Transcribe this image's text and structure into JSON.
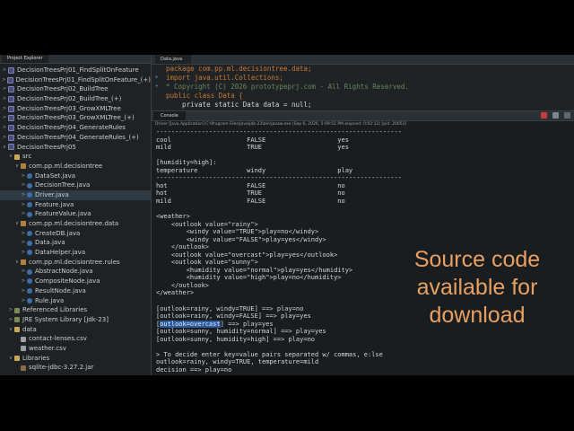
{
  "explorer": {
    "tab_label": "Project Explorer",
    "items": [
      {
        "label": "DecisionTreesPrj01_FindSplitOnFeature",
        "icon": "project-icon",
        "depth": 0,
        "twisty": ">"
      },
      {
        "label": "DecisionTreesPrj01_FindSplitOnFeature_(+)",
        "icon": "project-icon",
        "depth": 0,
        "twisty": ">"
      },
      {
        "label": "DecisionTreesPrj02_BuildTree",
        "icon": "project-icon",
        "depth": 0,
        "twisty": ">"
      },
      {
        "label": "DecisionTreesPrj02_BuildTree_(+)",
        "icon": "project-icon",
        "depth": 0,
        "twisty": ">"
      },
      {
        "label": "DecisionTreesPrj03_GrowXMLTree",
        "icon": "project-icon",
        "depth": 0,
        "twisty": ">"
      },
      {
        "label": "DecisionTreesPrj03_GrowXMLTree_(+)",
        "icon": "project-icon",
        "depth": 0,
        "twisty": ">"
      },
      {
        "label": "DecisionTreesPrj04_GenerateRules",
        "icon": "project-icon",
        "depth": 0,
        "twisty": ">"
      },
      {
        "label": "DecisionTreesPrj04_GenerateRules_(+)",
        "icon": "project-icon",
        "depth": 0,
        "twisty": ">"
      },
      {
        "label": "DecisionTreesPrj05",
        "icon": "project-icon",
        "depth": 0,
        "twisty": "v"
      },
      {
        "label": "src",
        "icon": "folder-icon",
        "depth": 1,
        "twisty": "v"
      },
      {
        "label": "com.pp.ml.decisiontree",
        "icon": "package-icon",
        "depth": 2,
        "twisty": "v"
      },
      {
        "label": "DataSet.java",
        "icon": "java-file-icon",
        "depth": 3,
        "twisty": ">"
      },
      {
        "label": "DecisionTree.java",
        "icon": "java-file-icon",
        "depth": 3,
        "twisty": ">"
      },
      {
        "label": "Driver.java",
        "icon": "java-file-icon",
        "depth": 3,
        "twisty": ">",
        "selected": true
      },
      {
        "label": "Feature.java",
        "icon": "java-file-icon",
        "depth": 3,
        "twisty": ">"
      },
      {
        "label": "FeatureValue.java",
        "icon": "java-file-icon",
        "depth": 3,
        "twisty": ">"
      },
      {
        "label": "com.pp.ml.decisiontree.data",
        "icon": "package-icon",
        "depth": 2,
        "twisty": "v"
      },
      {
        "label": "CreateDB.java",
        "icon": "java-file-icon",
        "depth": 3,
        "twisty": ">"
      },
      {
        "label": "Data.java",
        "icon": "java-file-icon",
        "depth": 3,
        "twisty": ">"
      },
      {
        "label": "DataHelper.java",
        "icon": "java-file-icon",
        "depth": 3,
        "twisty": ">"
      },
      {
        "label": "com.pp.ml.decisiontree.rules",
        "icon": "package-icon",
        "depth": 2,
        "twisty": "v"
      },
      {
        "label": "AbstractNode.java",
        "icon": "java-file-icon",
        "depth": 3,
        "twisty": ">"
      },
      {
        "label": "CompositeNode.java",
        "icon": "java-file-icon",
        "depth": 3,
        "twisty": ">"
      },
      {
        "label": "ResultNode.java",
        "icon": "java-file-icon",
        "depth": 3,
        "twisty": ">"
      },
      {
        "label": "Rule.java",
        "icon": "java-file-icon",
        "depth": 3,
        "twisty": ">"
      },
      {
        "label": "Referenced Libraries",
        "icon": "library-icon",
        "depth": 1,
        "twisty": ">"
      },
      {
        "label": "JRE System Library [jdk-23]",
        "icon": "library-icon",
        "depth": 1,
        "twisty": ">"
      },
      {
        "label": "data",
        "icon": "folder-icon",
        "depth": 1,
        "twisty": "v"
      },
      {
        "label": "contact-lenses.csv",
        "icon": "csv-file-icon",
        "depth": 2,
        "twisty": ""
      },
      {
        "label": "weather.csv",
        "icon": "csv-file-icon",
        "depth": 2,
        "twisty": ""
      },
      {
        "label": "Libraries",
        "icon": "folder-icon",
        "depth": 1,
        "twisty": "v"
      },
      {
        "label": "sqlite-jdbc-3.27.2.jar",
        "icon": "jar-file-icon",
        "depth": 2,
        "twisty": ""
      }
    ]
  },
  "editor": {
    "tab_label": "Data.java",
    "lines": [
      {
        "mark": "",
        "text": "package com.pp.ml.decisiontree.data;",
        "style": "kw"
      },
      {
        "mark": "+",
        "text": "import java.util.Collections;",
        "style": "kw"
      },
      {
        "mark": "+",
        "text": "* Copyright (C) 2026 prototypeprj.com - All Rights Reserved.",
        "style": "cm"
      },
      {
        "mark": "",
        "text": "public class Data {",
        "style": "kw"
      },
      {
        "mark": "",
        "text": "    private static Data data = null;",
        "style": ""
      }
    ]
  },
  "console": {
    "tab_label": "Console",
    "status": "Driver [Java Application] C:\\Program Files\\Java\\jdk-23\\bin\\javaw.exe (Sep 6, 2026, 5:09:51 PM elapsed: 0:02:12) [pid: 20052]",
    "lines": [
      "-----------------------------------------------------------------",
      "cool                    FALSE                   yes",
      "mild                    TRUE                    yes",
      "",
      "[humidity=high]:",
      "temperature             windy                   play",
      "-----------------------------------------------------------------",
      "hot                     FALSE                   no",
      "hot                     TRUE                    no",
      "mild                    FALSE                   no",
      "",
      "<weather>",
      "    <outlook value=\"rainy\">",
      "        <windy value=\"TRUE\">play=no</windy>",
      "        <windy value=\"FALSE\">play=yes</windy>",
      "    </outlook>",
      "    <outlook value=\"overcast\">play=yes</outlook>",
      "    <outlook value=\"sunny\">",
      "        <humidity value=\"normal\">play=yes</humidity>",
      "        <humidity value=\"high\">play=no</humidity>",
      "    </outlook>",
      "</weather>",
      "",
      "[outlook=rainy, windy=TRUE] ==> play=no",
      "[outlook=rainy, windy=FALSE] ==> play=yes",
      "[outlook=overcast] ==> play=yes",
      "[outlook=sunny, humidity=normal] ==> play=yes",
      "[outlook=sunny, humidity=high] ==> play=no",
      "",
      "> To decide enter key=value pairs separated w/ commas, e:lse",
      "outlook=rainy, windy=TRUE, temperature=mild",
      "decision ==> play=no"
    ],
    "highlight": {
      "line": 25,
      "text": "outlook=overcast"
    }
  },
  "overlay": {
    "lines": [
      "Source code",
      "available for",
      "download"
    ],
    "color": "#e8a062"
  }
}
